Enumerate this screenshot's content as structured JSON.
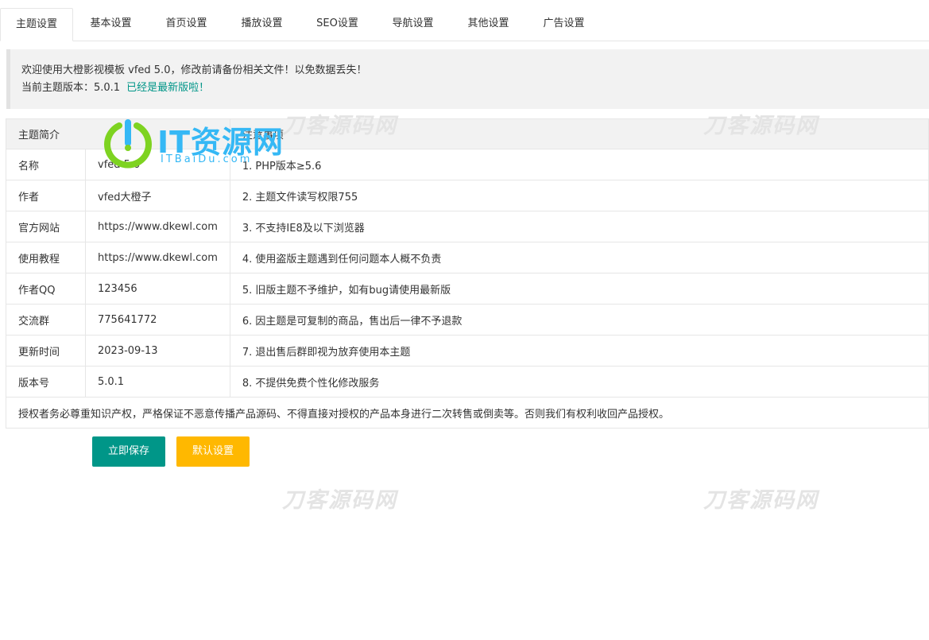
{
  "tabs": [
    {
      "label": "主题设置",
      "active": true
    },
    {
      "label": "基本设置",
      "active": false
    },
    {
      "label": "首页设置",
      "active": false
    },
    {
      "label": "播放设置",
      "active": false
    },
    {
      "label": "SEO设置",
      "active": false
    },
    {
      "label": "导航设置",
      "active": false
    },
    {
      "label": "其他设置",
      "active": false
    },
    {
      "label": "广告设置",
      "active": false
    }
  ],
  "notice": {
    "line1": "欢迎使用大橙影视模板 vfed 5.0，修改前请备份相关文件！以免数据丢失！",
    "version_label": "当前主题版本：5.0.1",
    "latest": "已经是最新版啦！",
    "latest_color": "#009688"
  },
  "table": {
    "header_left": "主题简介",
    "header_right": "注意事项",
    "rows": [
      {
        "key": "名称",
        "value": "vfed 5.0",
        "note": "1. PHP版本≥5.6"
      },
      {
        "key": "作者",
        "value": "vfed大橙子",
        "note": "2. 主题文件读写权限755"
      },
      {
        "key": "官方网站",
        "value": "https://www.dkewl.com",
        "note": "3. 不支持IE8及以下浏览器"
      },
      {
        "key": "使用教程",
        "value": "https://www.dkewl.com",
        "note": "4. 使用盗版主题遇到任何问题本人概不负责"
      },
      {
        "key": "作者QQ",
        "value": "123456",
        "note": "5. 旧版主题不予维护，如有bug请使用最新版"
      },
      {
        "key": "交流群",
        "value": "775641772",
        "note": "6. 因主题是可复制的商品，售出后一律不予退款"
      },
      {
        "key": "更新时间",
        "value": "2023-09-13",
        "note": "7. 退出售后群即视为放弃使用本主题"
      },
      {
        "key": "版本号",
        "value": "5.0.1",
        "note": "8. 不提供免费个性化修改服务"
      }
    ],
    "footer": "授权者务必尊重知识产权，严格保证不恶意传播产品源码、不得直接对授权的产品本身进行二次转售或倒卖等。否则我们有权利收回产品授权。"
  },
  "buttons": {
    "save": "立即保存",
    "default": "默认设置",
    "save_color": "#009688",
    "default_color": "#ffb800"
  },
  "watermark": {
    "text": "刀客源码网",
    "logo_text": "IT资源网",
    "logo_sub": "ITBaiDu.com",
    "logo_color": "#35b8f5",
    "logo_accent": "#7ed321"
  }
}
